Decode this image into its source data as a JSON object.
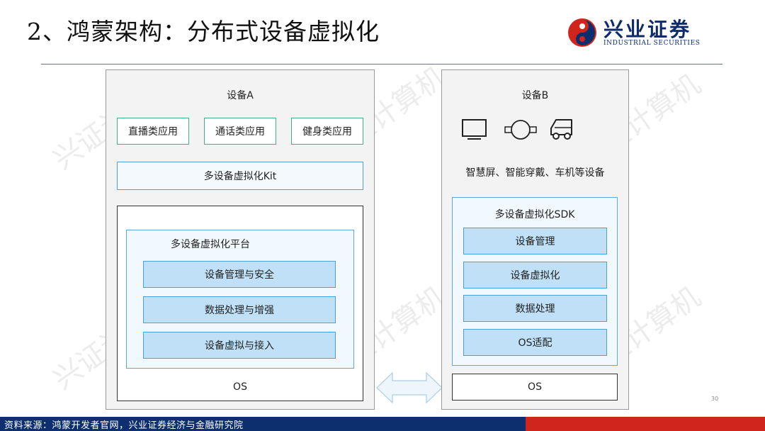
{
  "header": {
    "title": "2、鸿蒙架构：分布式设备虚拟化",
    "logo_text": "兴业证券",
    "logo_sub": "INDUSTRIAL SECURITIES"
  },
  "device_a": {
    "title": "设备A",
    "apps": [
      "直播类应用",
      "通话类应用",
      "健身类应用"
    ],
    "kit": "多设备虚拟化Kit",
    "platform_title": "多设备虚拟化平台",
    "platform_items": [
      "设备管理与安全",
      "数据处理与增强",
      "设备虚拟与接入"
    ],
    "os": "OS"
  },
  "device_b": {
    "title": "设备B",
    "icons": [
      "tv-icon",
      "watch-icon",
      "car-icon"
    ],
    "devices_caption": "智慧屏、智能穿戴、车机等设备",
    "sdk_title": "多设备虚拟化SDK",
    "sdk_items": [
      "设备管理",
      "设备虚拟化",
      "数据处理",
      "OS适配"
    ],
    "os": "OS"
  },
  "footer": {
    "source": "资料来源：鸿蒙开发者官网，兴业证券经济与金融研究院",
    "page_number": "30"
  },
  "watermark": "兴证计算机",
  "colors": {
    "navy": "#0e2f6e",
    "red": "#d0251c",
    "app_border": "#3fae8a",
    "item_fill": "#bfe0f7"
  }
}
